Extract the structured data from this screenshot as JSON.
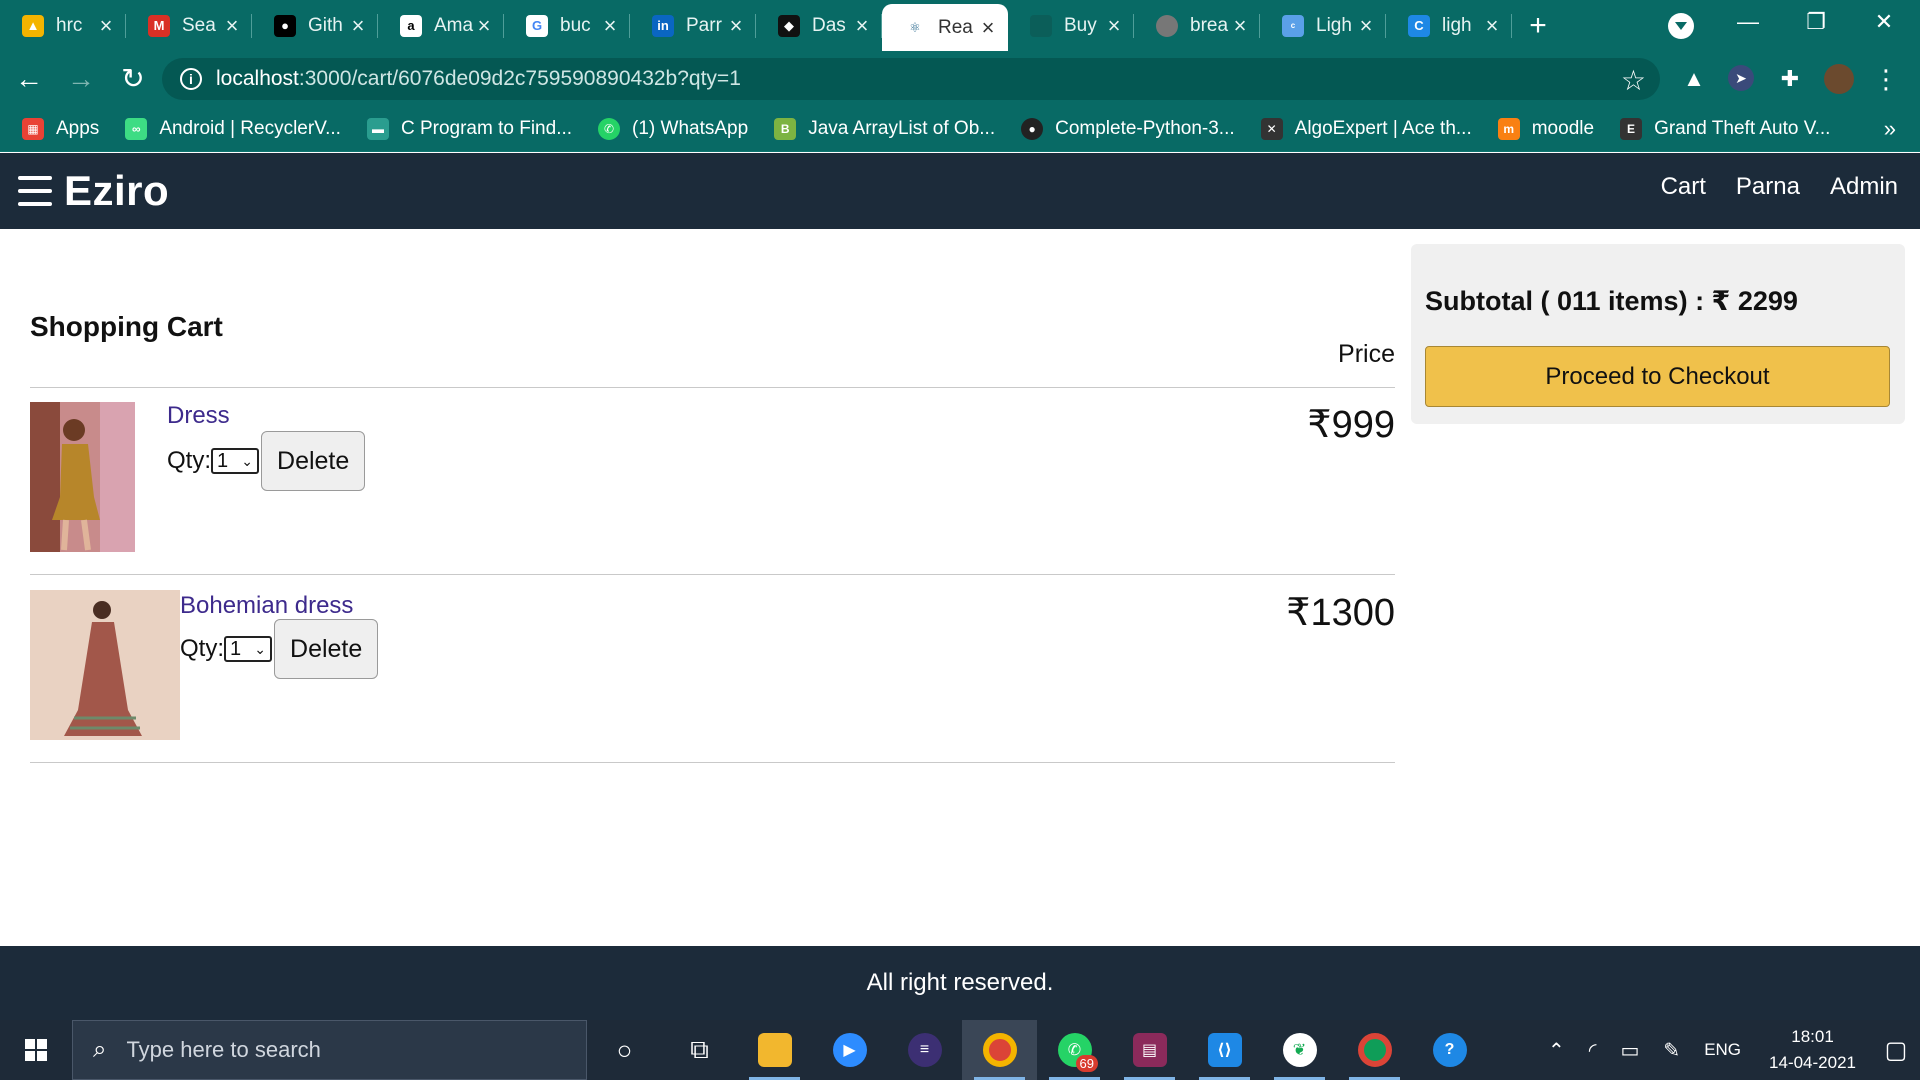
{
  "browser": {
    "tabs": [
      {
        "title": "hrc",
        "icon": "google-drive-icon",
        "color": "#f4b400"
      },
      {
        "title": "Sea",
        "icon": "gmail-icon",
        "color": "#d93025"
      },
      {
        "title": "Gith",
        "icon": "github-icon",
        "color": "#000000"
      },
      {
        "title": "Ama",
        "icon": "amazon-icon",
        "color": "#000000"
      },
      {
        "title": "buc",
        "icon": "google-icon",
        "color": "#4285f4"
      },
      {
        "title": "Parr",
        "icon": "linkedin-icon",
        "color": "#0a66c2"
      },
      {
        "title": "Das",
        "icon": "dashboard-icon",
        "color": "#111111"
      },
      {
        "title": "Rea",
        "icon": "react-icon",
        "color": "#61dafb",
        "active": true
      },
      {
        "title": "Buy",
        "icon": "shop-icon",
        "color": "#0b5e59"
      },
      {
        "title": "brea",
        "icon": "globe-icon",
        "color": "#777777"
      },
      {
        "title": "Ligh",
        "icon": "colory-icon",
        "color": "#5aa0e8"
      },
      {
        "title": "ligh",
        "icon": "c-icon",
        "color": "#1e88e5"
      }
    ],
    "url_host": "localhost",
    "url_rest": ":3000/cart/6076de09d2c759590890432b?qty=1",
    "bookmarks": [
      {
        "label": "Apps",
        "icon": "apps-grid-icon",
        "color": "#e94235"
      },
      {
        "label": "Android | RecyclerV...",
        "icon": "android-icon",
        "color": "#3ddc84"
      },
      {
        "label": "C Program to Find...",
        "icon": "site-icon",
        "color": "#2a9d8f"
      },
      {
        "label": "(1) WhatsApp",
        "icon": "whatsapp-icon",
        "color": "#25d366"
      },
      {
        "label": "Java ArrayList of Ob...",
        "icon": "bootstrap-icon",
        "color": "#7cb342"
      },
      {
        "label": "Complete-Python-3...",
        "icon": "github-icon",
        "color": "#222222"
      },
      {
        "label": "AlgoExpert | Ace th...",
        "icon": "algoexpert-icon",
        "color": "#333333"
      },
      {
        "label": "moodle",
        "icon": "moodle-icon",
        "color": "#f98012"
      },
      {
        "label": "Grand Theft Auto V...",
        "icon": "epic-icon",
        "color": "#333333"
      }
    ]
  },
  "app": {
    "brand": "Eziro",
    "nav": [
      "Cart",
      "Parna",
      "Admin"
    ],
    "cart_title": "Shopping Cart",
    "price_header": "Price",
    "qty_label": "Qty:",
    "delete_label": "Delete",
    "items": [
      {
        "name": "Dress",
        "qty": "1",
        "price": "₹999"
      },
      {
        "name": "Bohemian dress",
        "qty": "1",
        "price": "₹1300"
      }
    ],
    "subtotal": "Subtotal ( 011 items) : ₹ 2299",
    "checkout_label": "Proceed to Checkout",
    "footer": "All right reserved."
  },
  "taskbar": {
    "search_placeholder": "Type here to search",
    "whatsapp_badge": "69",
    "lang": "ENG",
    "time": "18:01",
    "date": "14-04-2021"
  },
  "colors": {
    "chrome": "#086a65",
    "navbar": "#1c2b3a",
    "checkout": "#f0c14b",
    "link": "#3d2a8c"
  }
}
